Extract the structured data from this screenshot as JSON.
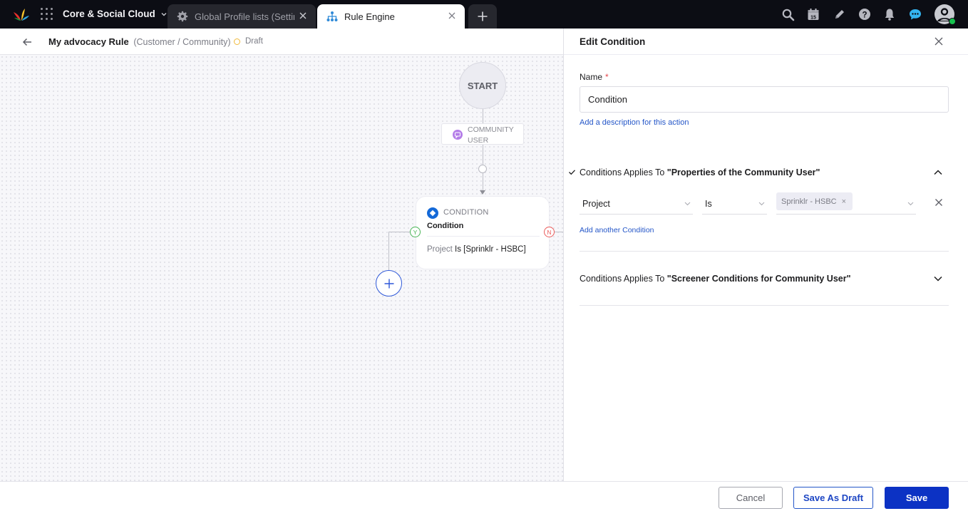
{
  "topbar": {
    "product_name": "Core & Social Cloud",
    "tabs": [
      {
        "label": "Global Profile lists (Settings)",
        "icon": "gear-icon",
        "active": false
      },
      {
        "label": "Rule Engine",
        "icon": "hierarchy-icon",
        "active": true
      }
    ],
    "new_tab_label": "+",
    "right_icons": [
      "search-icon",
      "calendar-icon",
      "pencil-icon",
      "help-icon",
      "bell-icon",
      "chat-icon",
      "avatar"
    ],
    "calendar_day": "15",
    "colors": {
      "bar": "#0c0d14",
      "chat": "#34b4f0",
      "online": "#17c24f"
    }
  },
  "subheader": {
    "title": "My advocacy Rule",
    "subtitle": "(Customer / Community)",
    "status": "Draft",
    "status_color": "#f0b93a"
  },
  "canvas": {
    "start_label": "START",
    "trigger": {
      "line1": "COMMUNITY",
      "line2": "USER"
    },
    "condition_node": {
      "type": "CONDITION",
      "name": "Condition",
      "field": "Project",
      "expression": "Is [Sprinklr - HSBC]",
      "yes_label": "Y",
      "no_label": "N"
    }
  },
  "panel": {
    "title": "Edit Condition",
    "name_label": "Name",
    "required_mark": "*",
    "name_value": "Condition",
    "add_description": "Add a description for this action",
    "sections": [
      {
        "prefix": "Conditions Applies To ",
        "target": "\"Properties of the Community User\"",
        "expanded": true,
        "rows": [
          {
            "field": "Project",
            "operator": "Is",
            "values": [
              "Sprinklr - HSBC"
            ]
          }
        ],
        "add_condition": "Add another Condition"
      },
      {
        "prefix": "Conditions Applies To ",
        "target": "\"Screener Conditions for Community User\"",
        "expanded": false
      }
    ]
  },
  "footer": {
    "cancel": "Cancel",
    "save_draft": "Save As Draft",
    "save": "Save"
  }
}
